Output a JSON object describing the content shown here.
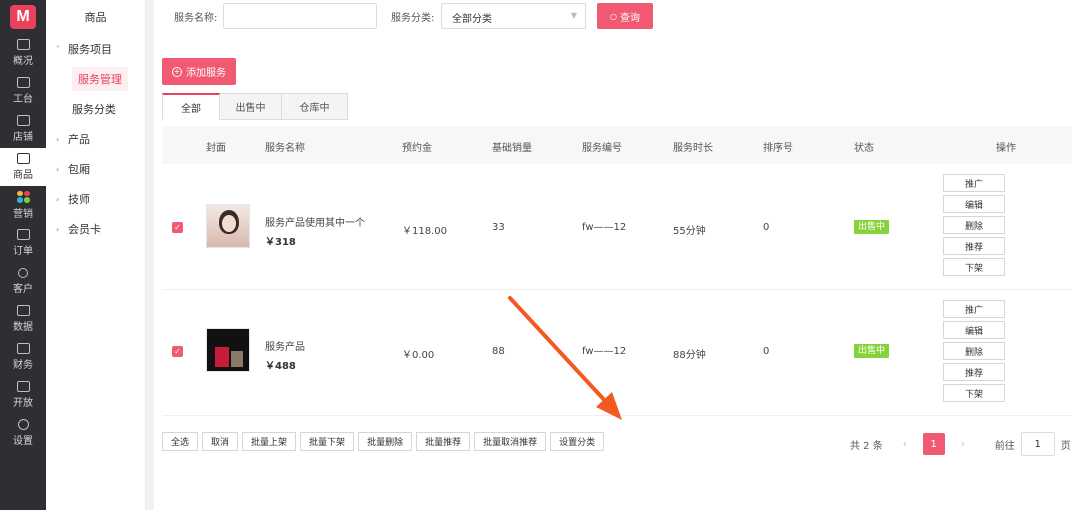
{
  "app": {
    "logo_letter": "M"
  },
  "rail": [
    {
      "label": "概况",
      "icon": "chart-icon"
    },
    {
      "label": "工台",
      "icon": "monitor-icon"
    },
    {
      "label": "店铺",
      "icon": "store-icon"
    },
    {
      "label": "商品",
      "icon": "bag-icon",
      "active": true
    },
    {
      "label": "营销",
      "icon": "apps-icon"
    },
    {
      "label": "订单",
      "icon": "order-icon"
    },
    {
      "label": "客户",
      "icon": "user-icon"
    },
    {
      "label": "数据",
      "icon": "trend-icon"
    },
    {
      "label": "财务",
      "icon": "wallet-icon"
    },
    {
      "label": "开放",
      "icon": "api-icon"
    },
    {
      "label": "设置",
      "icon": "gear-icon"
    }
  ],
  "submenu": {
    "title": "商品",
    "groups": [
      {
        "label": "服务项目",
        "chev": "˅"
      },
      {
        "label": "产品",
        "chev": "›"
      },
      {
        "label": "包厢",
        "chev": "›"
      },
      {
        "label": "技师",
        "chev": "›"
      },
      {
        "label": "会员卡",
        "chev": "›"
      }
    ],
    "subitems": [
      {
        "label": "服务管理",
        "active": true
      },
      {
        "label": "服务分类"
      }
    ]
  },
  "filter": {
    "name_label": "服务名称:",
    "name_value": "",
    "category_label": "服务分类:",
    "category_value": "全部分类",
    "query_label": "查询"
  },
  "add_button": "添加服务",
  "tabs": [
    "全部",
    "出售中",
    "仓库中"
  ],
  "columns": [
    "封面",
    "服务名称",
    "预约金",
    "基础销量",
    "服务编号",
    "服务时长",
    "排序号",
    "状态",
    "操作"
  ],
  "rows": [
    {
      "name": "服务产品使用其中一个",
      "price": "￥318",
      "deposit": "￥118.00",
      "sales": "33",
      "code": "fw——12",
      "duration": "55分钟",
      "sort": "0",
      "status": "出售中",
      "ops": [
        "推广",
        "编辑",
        "删除",
        "推荐",
        "下架"
      ]
    },
    {
      "name": "服务产品",
      "price": "￥488",
      "deposit": "￥0.00",
      "sales": "88",
      "code": "fw——12",
      "duration": "88分钟",
      "sort": "0",
      "status": "出售中",
      "ops": [
        "推广",
        "编辑",
        "删除",
        "推荐",
        "下架"
      ]
    }
  ],
  "bulk": [
    "全选",
    "取消",
    "批量上架",
    "批量下架",
    "批量删除",
    "批量推荐",
    "批量取消推荐",
    "设置分类"
  ],
  "pager": {
    "total": "共 2 条",
    "prev": "‹",
    "next": "›",
    "current": "1",
    "goto_label": "前往",
    "goto_value": "1",
    "page_unit": "页"
  },
  "colors": {
    "accent": "#f05a73",
    "status_green": "#86d23a",
    "arrow": "#f25a22"
  }
}
